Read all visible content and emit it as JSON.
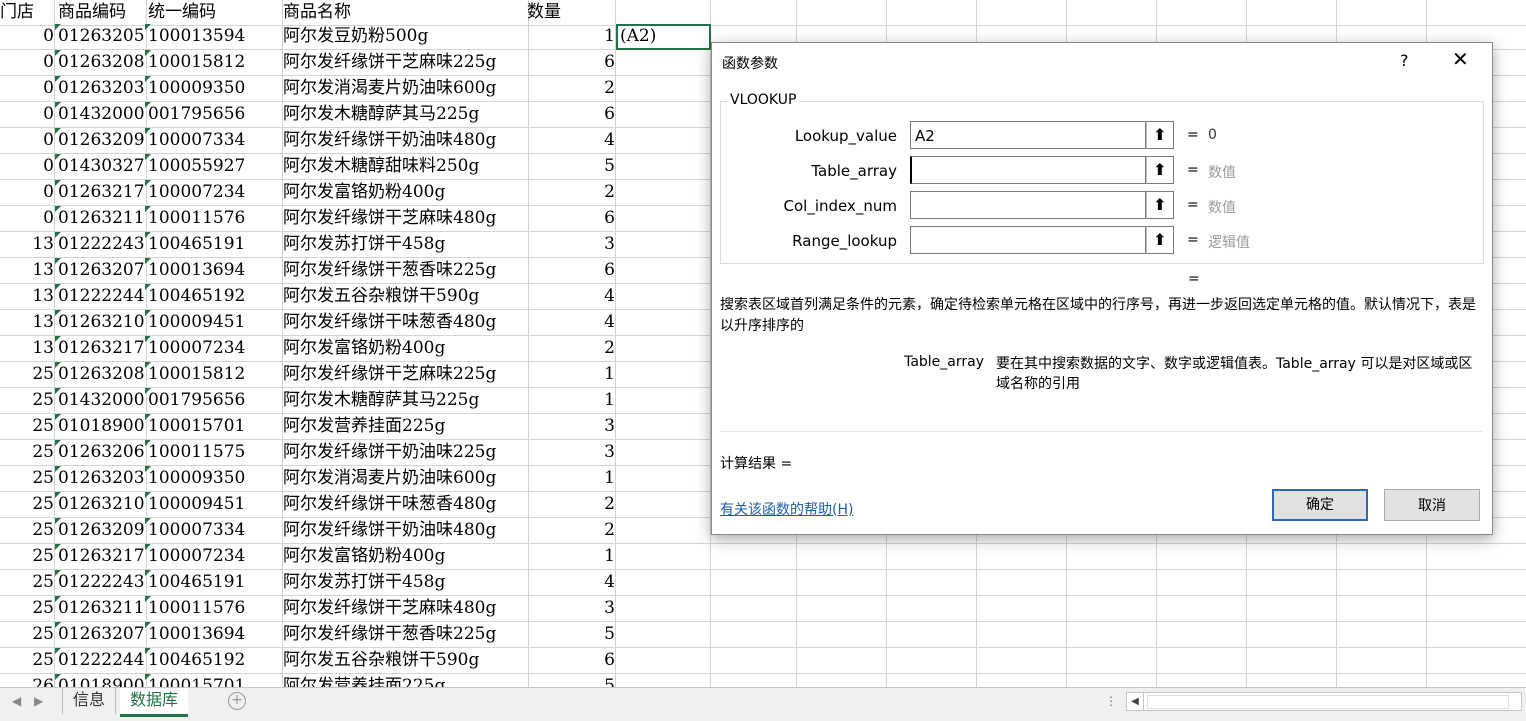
{
  "sheet": {
    "headers": [
      "门店",
      "商品编码",
      "统一编码",
      "商品名称",
      "数量"
    ],
    "rows": [
      [
        "0",
        "01263205",
        "100013594",
        "阿尔发豆奶粉500g",
        "1"
      ],
      [
        "0",
        "01263208",
        "100015812",
        "阿尔发纤缘饼干芝麻味225g",
        "6"
      ],
      [
        "0",
        "01263203",
        "100009350",
        "阿尔发消渴麦片奶油味600g",
        "2"
      ],
      [
        "0",
        "01432000",
        "001795656",
        "阿尔发木糖醇萨其马225g",
        "6"
      ],
      [
        "0",
        "01263209",
        "100007334",
        "阿尔发纤缘饼干奶油味480g",
        "4"
      ],
      [
        "0",
        "01430327",
        "100055927",
        "阿尔发木糖醇甜味料250g",
        "5"
      ],
      [
        "0",
        "01263217",
        "100007234",
        "阿尔发富铬奶粉400g",
        "2"
      ],
      [
        "0",
        "01263211",
        "100011576",
        "阿尔发纤缘饼干芝麻味480g",
        "6"
      ],
      [
        "13",
        "01222243",
        "100465191",
        "阿尔发苏打饼干458g",
        "3"
      ],
      [
        "13",
        "01263207",
        "100013694",
        "阿尔发纤缘饼干葱香味225g",
        "6"
      ],
      [
        "13",
        "01222244",
        "100465192",
        "阿尔发五谷杂粮饼干590g",
        "4"
      ],
      [
        "13",
        "01263210",
        "100009451",
        "阿尔发纤缘饼干味葱香480g",
        "4"
      ],
      [
        "13",
        "01263217",
        "100007234",
        "阿尔发富铬奶粉400g",
        "2"
      ],
      [
        "25",
        "01263208",
        "100015812",
        "阿尔发纤缘饼干芝麻味225g",
        "1"
      ],
      [
        "25",
        "01432000",
        "001795656",
        "阿尔发木糖醇萨其马225g",
        "1"
      ],
      [
        "25",
        "01018900",
        "100015701",
        "阿尔发营养挂面225g",
        "3"
      ],
      [
        "25",
        "01263206",
        "100011575",
        "阿尔发纤缘饼干奶油味225g",
        "3"
      ],
      [
        "25",
        "01263203",
        "100009350",
        "阿尔发消渴麦片奶油味600g",
        "1"
      ],
      [
        "25",
        "01263210",
        "100009451",
        "阿尔发纤缘饼干味葱香480g",
        "2"
      ],
      [
        "25",
        "01263209",
        "100007334",
        "阿尔发纤缘饼干奶油味480g",
        "2"
      ],
      [
        "25",
        "01263217",
        "100007234",
        "阿尔发富铬奶粉400g",
        "1"
      ],
      [
        "25",
        "01222243",
        "100465191",
        "阿尔发苏打饼干458g",
        "4"
      ],
      [
        "25",
        "01263211",
        "100011576",
        "阿尔发纤缘饼干芝麻味480g",
        "3"
      ],
      [
        "25",
        "01263207",
        "100013694",
        "阿尔发纤缘饼干葱香味225g",
        "5"
      ],
      [
        "25",
        "01222244",
        "100465192",
        "阿尔发五谷杂粮饼干590g",
        "6"
      ],
      [
        "26",
        "01018900",
        "100015701",
        "阿尔发营养挂面225g",
        "5"
      ]
    ],
    "active_cell_value": "(A2)"
  },
  "tabs": {
    "info": "信息",
    "database": "数据库",
    "add": "⊕"
  },
  "dialog": {
    "title": "函数参数",
    "help_icon": "?",
    "close_icon": "✕",
    "function_name": "VLOOKUP",
    "args": [
      {
        "label": "Lookup_value",
        "value": "A2",
        "result": "0"
      },
      {
        "label": "Table_array",
        "value": "",
        "result": "数值"
      },
      {
        "label": "Col_index_num",
        "value": "",
        "result": "数值"
      },
      {
        "label": "Range_lookup",
        "value": "",
        "result": "逻辑值"
      }
    ],
    "equals": "=",
    "description": "搜索表区域首列满足条件的元素，确定待检索单元格在区域中的行序号，再进一步返回选定单元格的值。默认情况下，表是以升序排序的",
    "param_name": "Table_array",
    "param_description": "要在其中搜索数据的文字、数字或逻辑值表。Table_array 可以是对区域或区域名称的引用",
    "calc_result": "计算结果 =",
    "help_link": "有关该函数的帮助(H)",
    "ok": "确定",
    "cancel": "取消"
  },
  "colors": {
    "accent": "#217346",
    "link": "#1a5fb4",
    "ok_border": "#2a6bb3"
  }
}
